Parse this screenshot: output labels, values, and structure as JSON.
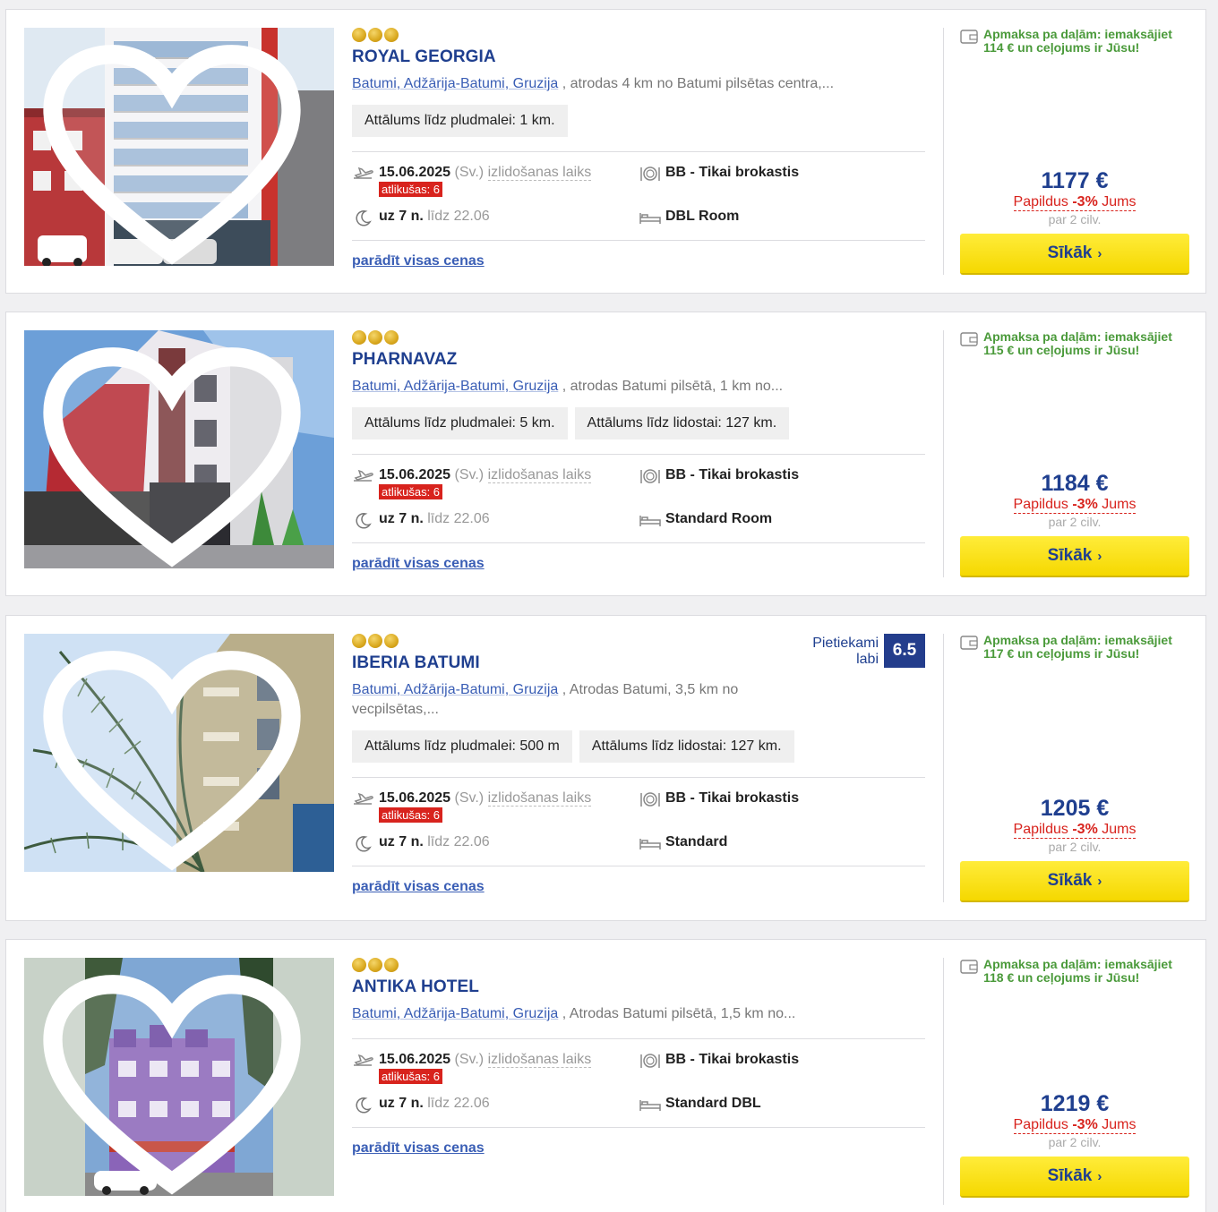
{
  "hotels": [
    {
      "name": "ROYAL GEORGIA",
      "location_link": "Batumi, Adžārija-Batumi, Gruzija",
      "location_text": " , atrodas 4 km no Batumi pilsētas centra,...",
      "tags": [
        "Attālums līdz pludmalei: 1 km."
      ],
      "date": "15.06.2025",
      "weekday": "(Sv.)",
      "departure_label": "izlidošanas laiks",
      "remaining": "atlikušas: 6",
      "nights": "uz 7 n.",
      "until": "līdz 22.06",
      "meal": "BB - Tikai brokastis",
      "room": "DBL Room",
      "show_prices": "parādīt visas cenas",
      "installment": "Apmaksa pa daļām: iemaksājiet 114 € un ceļojums ir Jūsu!",
      "price": "1177 €",
      "extra_prefix": "Papildus ",
      "extra_bold": "-3%",
      "extra_suffix": " Jums",
      "per_person": "par 2 cilv.",
      "button": "Sīkāk"
    },
    {
      "name": "PHARNAVAZ",
      "location_link": "Batumi, Adžārija-Batumi, Gruzija",
      "location_text": " , atrodas Batumi pilsētā, 1 km no...",
      "tags": [
        "Attālums līdz pludmalei: 5 km.",
        "Attālums līdz lidostai: 127 km."
      ],
      "date": "15.06.2025",
      "weekday": "(Sv.)",
      "departure_label": "izlidošanas laiks",
      "remaining": "atlikušas: 6",
      "nights": "uz 7 n.",
      "until": "līdz 22.06",
      "meal": "BB - Tikai brokastis",
      "room": "Standard Room",
      "show_prices": "parādīt visas cenas",
      "installment": "Apmaksa pa daļām: iemaksājiet 115 € un ceļojums ir Jūsu!",
      "price": "1184 €",
      "extra_prefix": "Papildus ",
      "extra_bold": "-3%",
      "extra_suffix": " Jums",
      "per_person": "par 2 cilv.",
      "button": "Sīkāk"
    },
    {
      "name": "IBERIA BATUMI",
      "location_link": "Batumi, Adžārija-Batumi, Gruzija",
      "location_text": " , Atrodas Batumi, 3,5 km no vecpilsētas,...",
      "tags": [
        "Attālums līdz pludmalei: 500 m",
        "Attālums līdz lidostai: 127 km."
      ],
      "rating_label_1": "Pietiekami",
      "rating_label_2": "labi",
      "rating_score": "6.5",
      "date": "15.06.2025",
      "weekday": "(Sv.)",
      "departure_label": "izlidošanas laiks",
      "remaining": "atlikušas: 6",
      "nights": "uz 7 n.",
      "until": "līdz 22.06",
      "meal": "BB - Tikai brokastis",
      "room": "Standard",
      "show_prices": "parādīt visas cenas",
      "installment": "Apmaksa pa daļām: iemaksājiet 117 € un ceļojums ir Jūsu!",
      "price": "1205 €",
      "extra_prefix": "Papildus ",
      "extra_bold": "-3%",
      "extra_suffix": " Jums",
      "per_person": "par 2 cilv.",
      "button": "Sīkāk"
    },
    {
      "name": "ANTIKA HOTEL",
      "location_link": "Batumi, Adžārija-Batumi, Gruzija",
      "location_text": " , Atrodas Batumi pilsētā, 1,5 km no...",
      "tags": [],
      "date": "15.06.2025",
      "weekday": "(Sv.)",
      "departure_label": "izlidošanas laiks",
      "remaining": "atlikušas: 6",
      "nights": "uz 7 n.",
      "until": "līdz 22.06",
      "meal": "BB - Tikai brokastis",
      "room": "Standard DBL",
      "show_prices": "parādīt visas cenas",
      "installment": "Apmaksa pa daļām: iemaksājiet 118 € un ceļojums ir Jūsu!",
      "price": "1219 €",
      "extra_prefix": "Papildus ",
      "extra_bold": "-3%",
      "extra_suffix": " Jums",
      "per_person": "par 2 cilv.",
      "button": "Sīkāk"
    }
  ],
  "colors": {
    "brand_blue": "#1f3f8f",
    "link_blue": "#3a5eb5",
    "accent_red": "#d8231d",
    "green": "#4a9a3a",
    "button_yellow": "#f5d800"
  },
  "icons": [
    "heart-icon",
    "plane-icon",
    "plate-icon",
    "moon-icon",
    "bed-icon",
    "wallet-icon",
    "chevron-right-icon"
  ]
}
